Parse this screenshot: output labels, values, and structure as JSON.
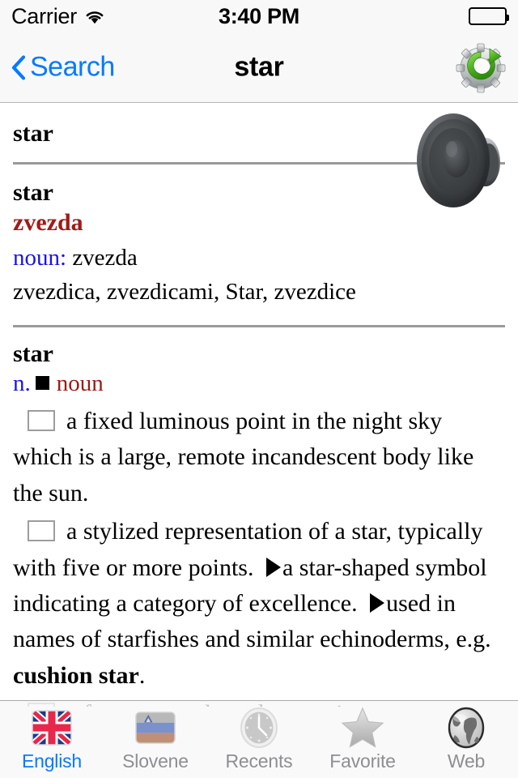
{
  "statusbar": {
    "carrier": "Carrier",
    "wifi_icon": "wifi-icon",
    "time": "3:40 PM",
    "battery_icon": "battery-full-icon"
  },
  "navbar": {
    "back_icon": "chevron-left-icon",
    "back_label": "Search",
    "title": "star",
    "action_icon": "gear-refresh-icon"
  },
  "entry": {
    "headword": "star",
    "speaker_icon": "speaker-icon",
    "translation": {
      "headword": "star",
      "target_word": "zvezda",
      "pos_label": "noun:",
      "pos_translation": " zvezda",
      "forms": "zvezdica, zvezdicami, Star, zvezdice"
    },
    "definition": {
      "headword": "star",
      "pos_abbr": "n.",
      "pos_marker_icon": "black-square-icon",
      "pos_full": "noun",
      "senses": [
        {
          "bullet_icon": "missing-glyph-box",
          "text": "a fixed luminous point in the night sky which is a large, remote incandescent body like the sun."
        },
        {
          "bullet_icon": "missing-glyph-box",
          "text_part1": "a stylized representation of a star, typically with five or more points. ",
          "sub_marker_icon": "triangle-right-icon",
          "text_part2": "a star-shaped symbol indicating a category of excellence. ",
          "sub_marker_icon2": "triangle-right-icon",
          "text_part3": "used in names of starfishes and similar echinoderms, e.g. ",
          "bold_term": "cushion star",
          "text_part4": "."
        },
        {
          "bullet_icon": "missing-glyph-box",
          "text": "a famous or talented entertainer or sports"
        }
      ]
    }
  },
  "tabbar": {
    "tabs": [
      {
        "label": "English",
        "icon": "uk-flag-icon",
        "active": true
      },
      {
        "label": "Slovene",
        "icon": "slovenia-flag-icon",
        "active": false
      },
      {
        "label": "Recents",
        "icon": "clock-icon",
        "active": false
      },
      {
        "label": "Favorite",
        "icon": "star-icon",
        "active": false
      },
      {
        "label": "Web",
        "icon": "globe-icon",
        "active": false
      }
    ]
  },
  "colors": {
    "accent_blue": "#067aff",
    "translation_red": "#a01b18",
    "pos_blue": "#1b12e8",
    "pos_red": "#9b1b16",
    "tab_inactive": "#8e8e93"
  }
}
